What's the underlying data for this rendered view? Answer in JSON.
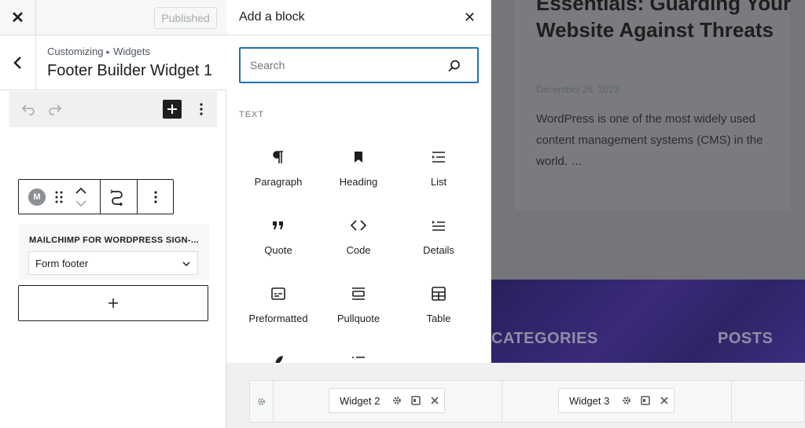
{
  "customizer": {
    "close_symbol": "✕",
    "published_label": "Published",
    "breadcrumb": [
      "Customizing",
      "Widgets"
    ],
    "breadcrumb_sep": "▸",
    "panel_title": "Footer Builder Widget 1",
    "block_logo_text": "M",
    "widget": {
      "title": "MAILCHIMP FOR WORDPRESS SIGN-...",
      "form_selected": "Form footer"
    }
  },
  "inserter": {
    "title": "Add a block",
    "close_symbol": "✕",
    "search_placeholder": "Search",
    "category": "TEXT",
    "blocks": [
      {
        "label": "Paragraph",
        "icon": "paragraph-icon"
      },
      {
        "label": "Heading",
        "icon": "heading-icon"
      },
      {
        "label": "List",
        "icon": "list-icon"
      },
      {
        "label": "Quote",
        "icon": "quote-icon"
      },
      {
        "label": "Code",
        "icon": "code-icon"
      },
      {
        "label": "Details",
        "icon": "details-icon"
      },
      {
        "label": "Preformatted",
        "icon": "preformatted-icon"
      },
      {
        "label": "Pullquote",
        "icon": "pullquote-icon"
      },
      {
        "label": "Table",
        "icon": "table-icon"
      }
    ]
  },
  "preview": {
    "post_title": "Essentials: Guarding Your Website Against Threats",
    "post_date": "December 26, 2023",
    "post_excerpt": "WordPress is one of the most widely used content management systems (CMS) in the world. …",
    "footer_categories": "CATEGORIES",
    "footer_posts": "POSTS"
  },
  "builder": {
    "widgets": [
      {
        "label": "Widget 2"
      },
      {
        "label": "Widget 3"
      }
    ]
  },
  "colors": {
    "focus_blue": "#2271b1",
    "footer_purple": "#3a2a7a"
  }
}
